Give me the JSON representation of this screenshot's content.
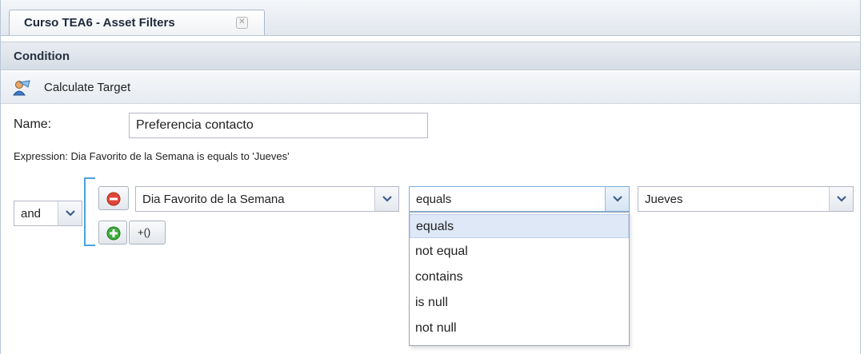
{
  "tab": {
    "title": "Curso TEA6 - Asset Filters",
    "close_glyph": "✕"
  },
  "panel": {
    "title": "Condition"
  },
  "toolbar": {
    "calculate_target_label": "Calculate Target",
    "calculate_target_icon": "users-calculate-icon"
  },
  "form": {
    "name_label": "Name:",
    "name_value": "Preferencia contacto",
    "expression_text": "Expression: Dia Favorito de la Semana is equals to 'Jueves'"
  },
  "condition": {
    "logic_operator": "and",
    "field": "Dia Favorito de la Semana",
    "operator": "equals",
    "value": "Jueves",
    "add_group_label": "+()",
    "remove_icon": "minus-circle-icon",
    "add_icon": "plus-circle-icon"
  },
  "operator_dropdown": {
    "options": [
      "equals",
      "not equal",
      "contains",
      "is null",
      "not null"
    ],
    "selected": "equals"
  },
  "colors": {
    "accent_blue": "#4aa3df",
    "remove_red": "#e0463a",
    "add_green": "#3cae3a",
    "selected_row": "#dfe8f6"
  }
}
